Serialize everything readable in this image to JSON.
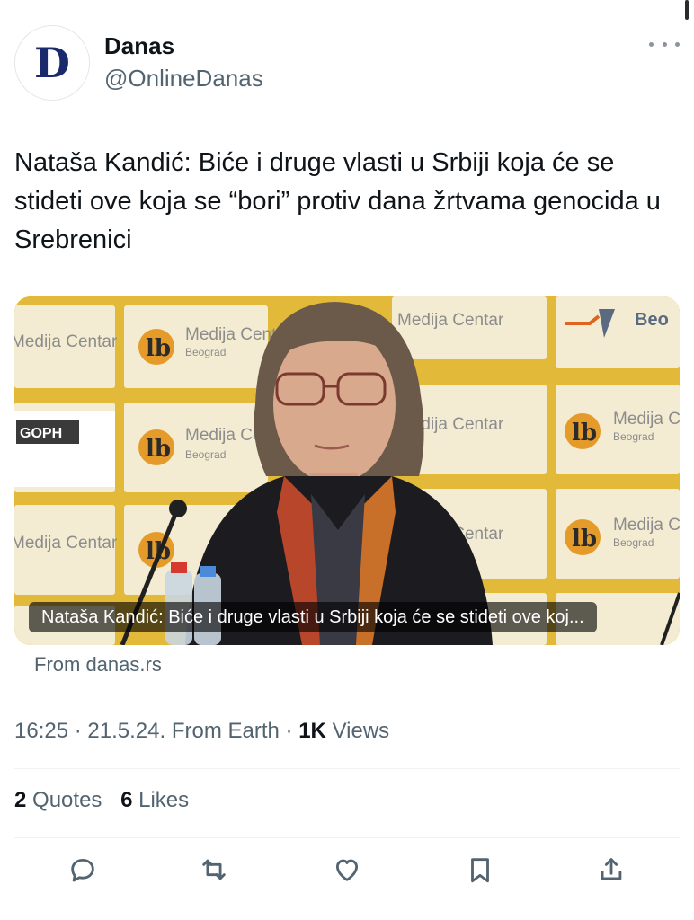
{
  "account": {
    "avatar_letter": "D",
    "display_name": "Danas",
    "handle": "@OnlineDanas"
  },
  "tweet": {
    "text": "Nataša Kandić: Biće i druge vlasti u Srbiji koja će se stideti ove koja se “bori” protiv dana žrtvama genocida u Srebrenici"
  },
  "card": {
    "caption": "Nataša Kandić: Biće i druge vlasti u Srbiji koja će se stideti ove koj...",
    "source": "From danas.rs",
    "backdrop_brand": "Medija Centar",
    "backdrop_city": "Beograd",
    "backdrop_partial": "Beo",
    "backdrop_logo": "GOPH"
  },
  "meta": {
    "time": "16:25",
    "date": "21.5.24.",
    "from": "From Earth",
    "views_count": "1K",
    "views_label": "Views"
  },
  "stats": {
    "quotes_count": "2",
    "quotes_label": "Quotes",
    "likes_count": "6",
    "likes_label": "Likes"
  },
  "icons": {
    "more": "more-icon",
    "reply": "reply-icon",
    "retweet": "retweet-icon",
    "like": "heart-icon",
    "bookmark": "bookmark-icon",
    "share": "share-icon"
  },
  "colors": {
    "text_primary": "#0f1419",
    "text_secondary": "#536471",
    "divider": "#eff3f4",
    "brand_navy": "#1a2a6c",
    "backdrop_yellow": "#e9c44a"
  }
}
